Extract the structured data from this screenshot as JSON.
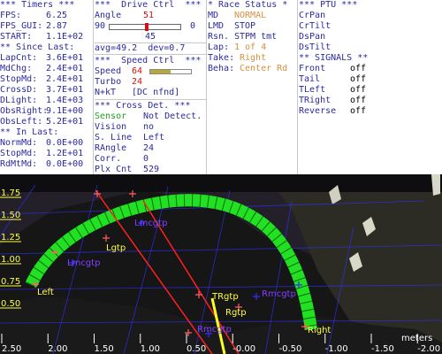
{
  "timers": {
    "header": "*** Timers ***",
    "fps_label": "FPS:",
    "fps": "6.25",
    "fpsgui_label": "FPS_GUI:",
    "fpsgui": "2.87",
    "start_label": "START:",
    "start": "1.1E+02",
    "since_header": "** Since Last:",
    "since": [
      {
        "label": "LapCnt:",
        "value": "3.6E+01"
      },
      {
        "label": "MdChg:",
        "value": "2.4E+01"
      },
      {
        "label": "StopMd:",
        "value": "2.4E+01"
      },
      {
        "label": "CrossD:",
        "value": "3.7E+01"
      },
      {
        "label": "DLight:",
        "value": "1.4E+03"
      },
      {
        "label": "ObsRight:",
        "value": "9.1E+00"
      },
      {
        "label": "ObsLeft:",
        "value": "5.2E+01"
      }
    ],
    "inlast_header": "** In Last:",
    "inlast": [
      {
        "label": "NormMd:",
        "value": "0.0E+00"
      },
      {
        "label": "StopMd:",
        "value": "1.2E+01"
      },
      {
        "label": "RdMtMd:",
        "value": "0.0E+00"
      }
    ]
  },
  "drive": {
    "header": "***  Drive Ctrl  ***",
    "angle_label": "Angle",
    "angle": "51",
    "slider_min": "90",
    "slider_max": "0",
    "slider_value": "45",
    "slider_fraction": 0.5,
    "avg_line": "avg=49.2  dev=0.7",
    "speed_header": "***  Speed Ctrl  ***",
    "speed_label": "Speed",
    "speed": "64",
    "speed_fraction": 0.5,
    "turbo_label": "Turbo",
    "turbo": "24",
    "nkt_label": "N+kT",
    "nkt": "[DC nfnd]",
    "cross_header": "*** Cross Det. ***",
    "sensor_label": "Sensor",
    "sensor": "Not Detect.",
    "cross_rows": [
      {
        "label": "Vision",
        "value": "no"
      },
      {
        "label": "S. Line",
        "value": "Left"
      },
      {
        "label": "RAngle",
        "value": "24"
      },
      {
        "label": "Corr.",
        "value": "0"
      },
      {
        "label": "Plx Cnt",
        "value": "529"
      }
    ]
  },
  "race": {
    "header": "* Race Status *",
    "md_label": "MD",
    "md": "NORMAL",
    "lmd_label": "LMD",
    "lmd": "STOP",
    "rsn_label": "Rsn.",
    "rsn": "STPM tmt",
    "lap_label": "Lap:",
    "lap": "1 of 4",
    "take_label": "Take:",
    "take": "Right",
    "beha_label": "Beha:",
    "beha": "Center Rd"
  },
  "ptu": {
    "header": "*** PTU ***",
    "items": [
      "CrPan",
      "CrTilt",
      "DsPan",
      "DsTilt"
    ],
    "signals_header": "** SIGNALS **",
    "signals": [
      {
        "label": "Front",
        "value": "off"
      },
      {
        "label": "Tail",
        "value": "off"
      },
      {
        "label": "TLeft",
        "value": "off"
      },
      {
        "label": "TRight",
        "value": "off"
      },
      {
        "label": "Reverse",
        "value": "off"
      }
    ]
  },
  "view": {
    "y_ticks": [
      {
        "label": "1.75",
        "y": 1.75
      },
      {
        "label": "1.50",
        "y": 1.5
      },
      {
        "label": "1.25",
        "y": 1.25
      },
      {
        "label": "1.00",
        "y": 1.0
      },
      {
        "label": "0.75",
        "y": 0.75
      },
      {
        "label": "0.50",
        "y": 0.5
      }
    ],
    "x_ticks": [
      {
        "label": "2.50",
        "x": 2.5
      },
      {
        "label": "2.00",
        "x": 2.0
      },
      {
        "label": "1.50",
        "x": 1.5
      },
      {
        "label": "1.00",
        "x": 1.0
      },
      {
        "label": "0.50",
        "x": 0.5
      },
      {
        "label": "-0.00",
        "x": 0.0
      },
      {
        "label": "-0.50",
        "x": -0.5
      },
      {
        "label": "-1.00",
        "x": -1.0
      },
      {
        "label": "-1.50",
        "x": -1.5
      },
      {
        "label": "-2.00",
        "x": -2.0
      }
    ],
    "units": "meters",
    "left_label": "Left",
    "right_label": "Right",
    "landmarks": [
      "Lmcgtp",
      "Lgtp",
      "Lmcgtp",
      "TRgtp",
      "Rgtp",
      "Rmcgtp",
      "Rmcgtp"
    ],
    "colors": {
      "track": "#22e022",
      "grid": "#3030ff",
      "lines": "#ff2020",
      "marks": "#ff6060",
      "gate": "#ffff20",
      "label_blue": "#8040ff",
      "label_yellow": "#ffff40",
      "ytick": "#ffff40"
    }
  }
}
